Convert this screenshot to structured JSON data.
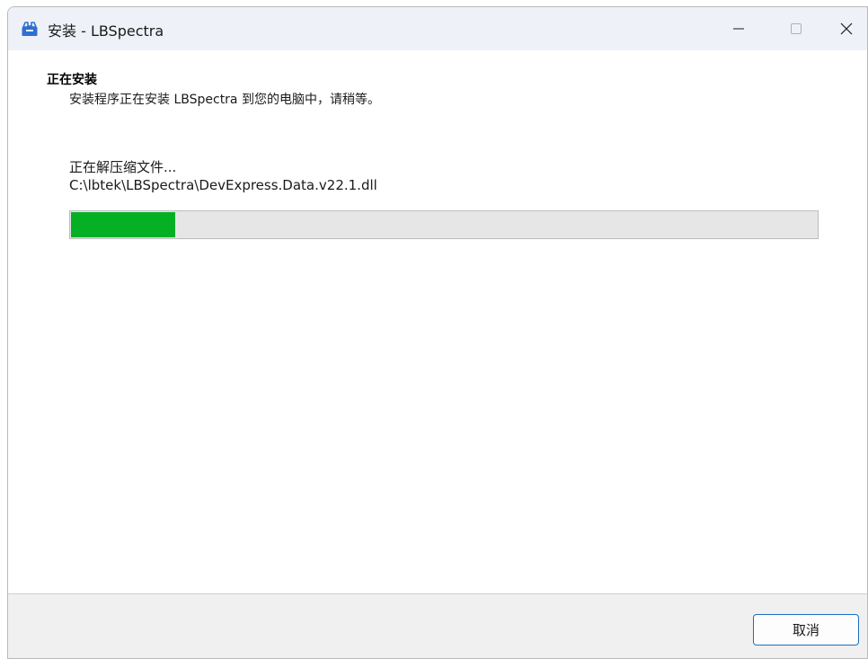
{
  "window": {
    "title": "安装 - LBSpectra",
    "icon": "installer-box-icon",
    "controls": [
      "minimize-icon",
      "maximize-icon",
      "close-icon"
    ]
  },
  "page": {
    "heading": "正在安装",
    "subheading": "安装程序正在安装 LBSpectra 到您的电脑中，请稍等。"
  },
  "progress": {
    "status": "正在解压缩文件...",
    "current_file": "C:\\lbtek\\LBSpectra\\DevExpress.Data.v22.1.dll",
    "fraction": 0.14,
    "fill_color": "#06b025"
  },
  "footer": {
    "cancel_label": "取消"
  },
  "colors": {
    "titlebar": "#eef2f8",
    "accent_border": "#1b6ec2",
    "icon_blue": "#2f6fd0"
  }
}
